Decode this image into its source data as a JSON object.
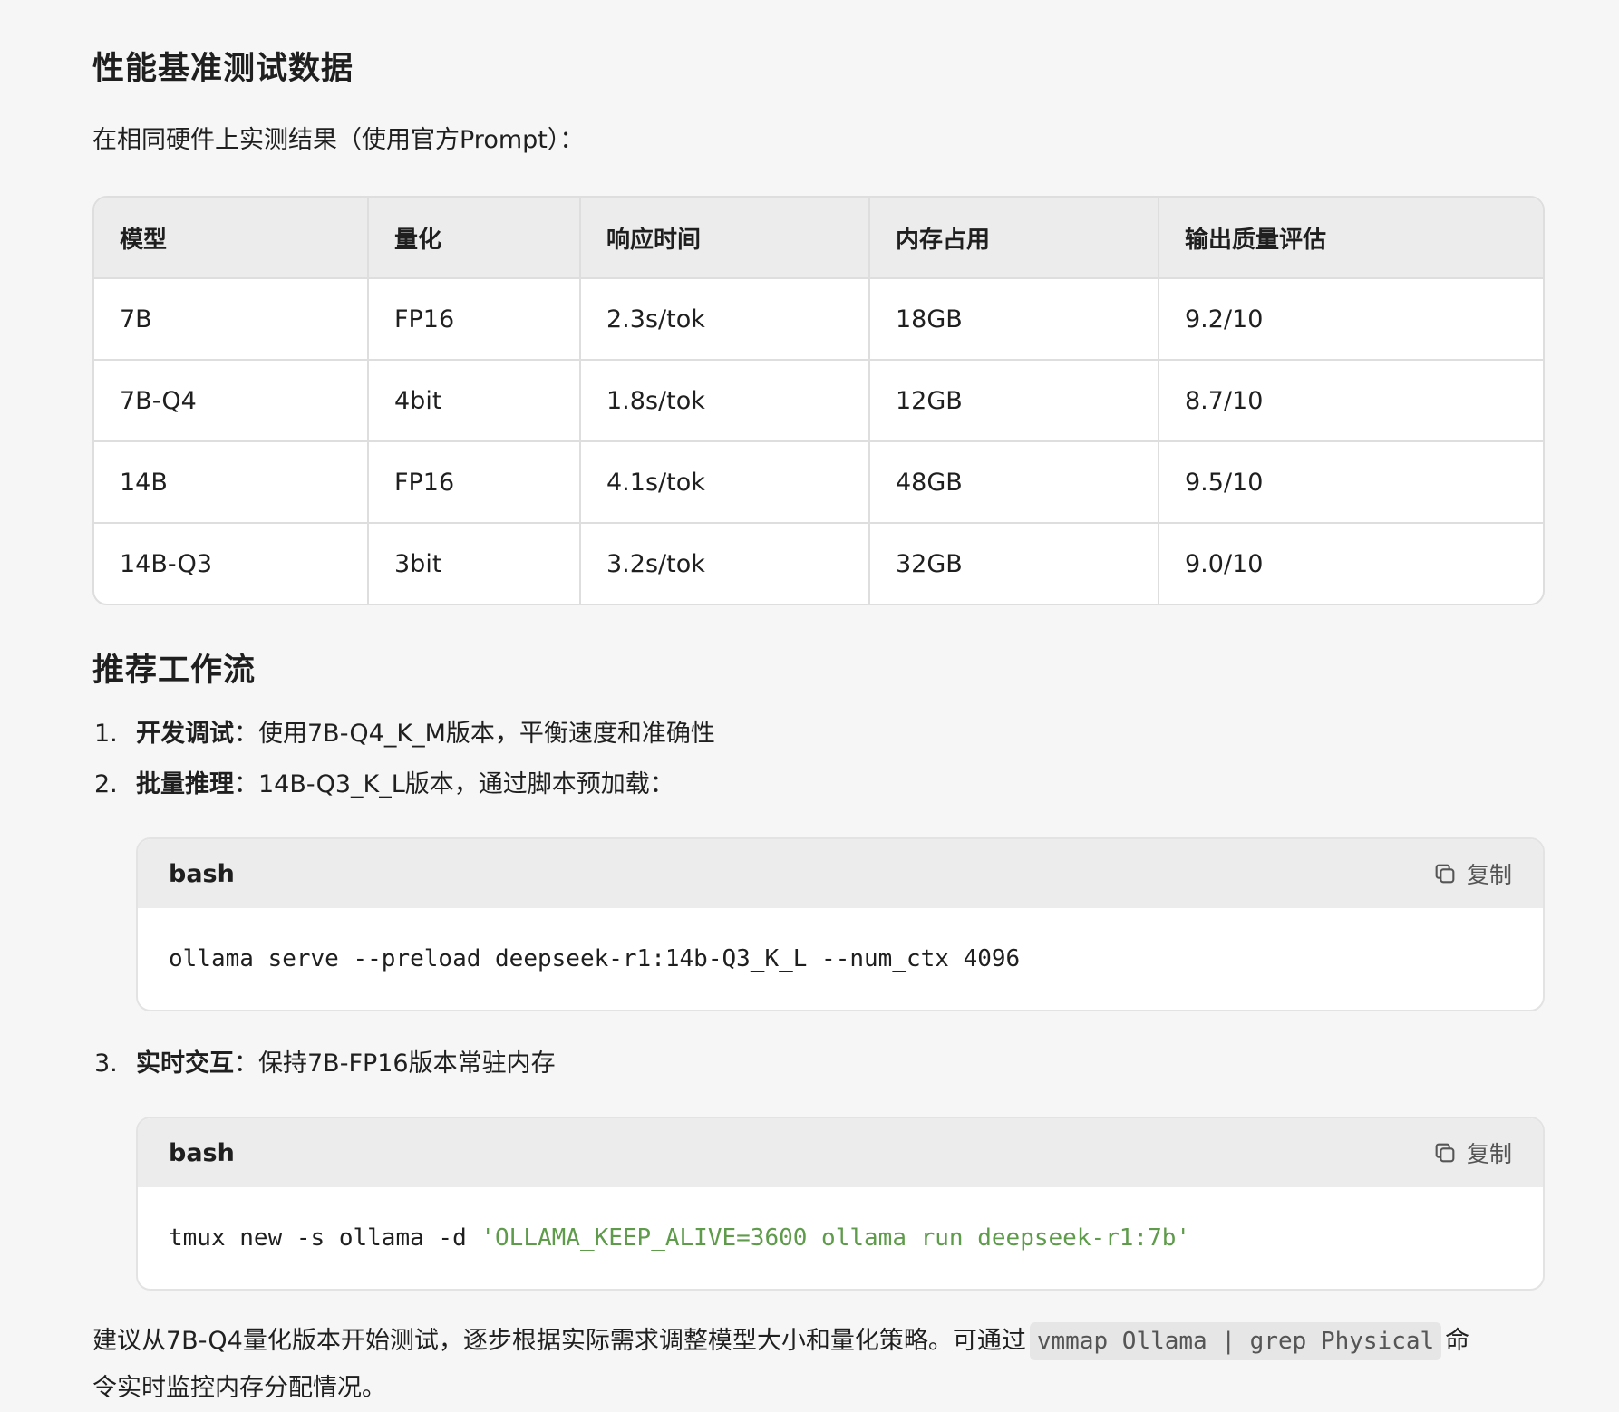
{
  "section1": {
    "title": "性能基准测试数据",
    "intro": "在相同硬件上实测结果（使用官方Prompt）："
  },
  "table": {
    "headers": [
      "模型",
      "量化",
      "响应时间",
      "内存占用",
      "输出质量评估"
    ],
    "rows": [
      [
        "7B",
        "FP16",
        "2.3s/tok",
        "18GB",
        "9.2/10"
      ],
      [
        "7B-Q4",
        "4bit",
        "1.8s/tok",
        "12GB",
        "8.7/10"
      ],
      [
        "14B",
        "FP16",
        "4.1s/tok",
        "48GB",
        "9.5/10"
      ],
      [
        "14B-Q3",
        "3bit",
        "3.2s/tok",
        "32GB",
        "9.0/10"
      ]
    ]
  },
  "section2": {
    "title": "推荐工作流"
  },
  "steps": [
    {
      "num": "1.",
      "bold": "开发调试",
      "text": "：使用7B-Q4_K_M版本，平衡速度和准确性"
    },
    {
      "num": "2.",
      "bold": "批量推理",
      "text": "：14B-Q3_K_L版本，通过脚本预加载："
    },
    {
      "num": "3.",
      "bold": "实时交互",
      "text": "：保持7B-FP16版本常驻内存"
    }
  ],
  "code_blocks": [
    {
      "lang": "bash",
      "copy_label": "复制",
      "code": "ollama serve --preload deepseek-r1:14b-Q3_K_L --num_ctx 4096",
      "code_string": ""
    },
    {
      "lang": "bash",
      "copy_label": "复制",
      "code": "tmux new -s ollama -d ",
      "code_string": "'OLLAMA_KEEP_ALIVE=3600 ollama run deepseek-r1:7b'"
    }
  ],
  "footer": {
    "text_before": "建议从7B-Q4量化版本开始测试，逐步根据实际需求调整模型大小和量化策略。可通过",
    "inline_code": "vmmap Ollama | grep Physical",
    "text_after": "命令实时监控内存分配情况。"
  },
  "colors": {
    "background": "#f6f6f6",
    "code_string": "#5e9b4a",
    "header_bg": "#ececec"
  },
  "icons": {
    "copy": "copy-icon"
  }
}
